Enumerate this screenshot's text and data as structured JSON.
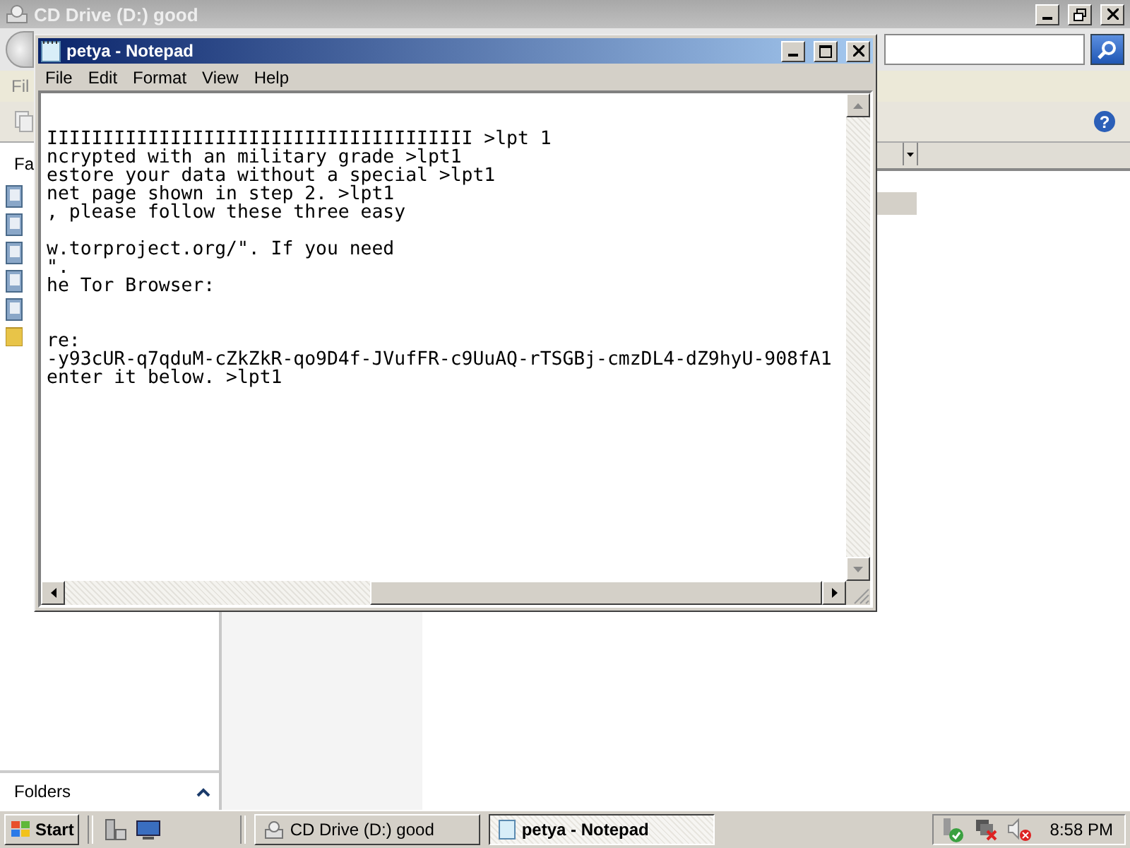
{
  "explorer": {
    "title": "CD Drive (D:) good",
    "menu_partial": "Fil",
    "pane_partial": "Fa",
    "folders_label": "Folders",
    "help_glyph": "?"
  },
  "notepad": {
    "title": "petya - Notepad",
    "menu": [
      "File",
      "Edit",
      "Format",
      "View",
      "Help"
    ],
    "text": "\n\nIIIIIIIIIIIIIIIIIIIIIIIIIIIIIIIIIIIIII >lpt 1\nncrypted with an military grade >lpt1\nestore your data without a special >lpt1\nnet page shown in step 2. >lpt1\n, please follow these three easy\n\nw.torproject.org/\". If you need\n\".\nhe Tor Browser:\n\n\nre:\n-y93cUR-q7qduM-cZkZkR-qo9D4f-JVufFR-c9UuAQ-rTSGBj-cmzDL4-dZ9hyU-908fA1\nenter it below. >lpt1"
  },
  "taskbar": {
    "start": "Start",
    "tasks": [
      {
        "label": "CD Drive (D:) good",
        "selected": false
      },
      {
        "label": "petya - Notepad",
        "selected": true
      }
    ],
    "clock": "8:58 PM"
  }
}
